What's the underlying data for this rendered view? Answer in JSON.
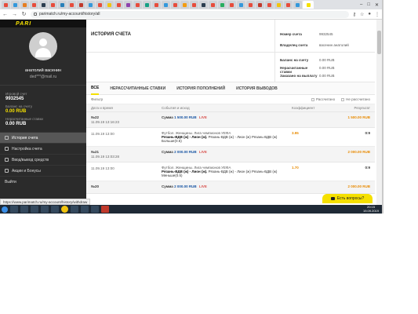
{
  "browser": {
    "url": "parimatch.ru/my-account/history/all",
    "status_url": "https://www.parimatch.ru/my-account/history/withdraw"
  },
  "colors": {
    "accent": "#f5e000",
    "sidebar": "#2b2b2b",
    "live": "#d9534f",
    "amount": "#e88a00"
  },
  "sidebar": {
    "user_name": "анатолий васенин",
    "user_email": "ded***@mail.ru",
    "account_label": "Игровой счет",
    "account_number": "9932545",
    "balance_label": "Баланс на счету",
    "balance_value": "0.00 RUB",
    "unsettled_label": "Нерасчитанные ставки",
    "unsettled_value": "0.00 RUB",
    "menu": [
      {
        "label": "История счета",
        "icon": "history-icon"
      },
      {
        "label": "Настройка счета",
        "icon": "settings-icon"
      },
      {
        "label": "Ввод/вывод средств",
        "icon": "wallet-icon"
      },
      {
        "label": "Акции и Бонусы",
        "icon": "gift-icon"
      },
      {
        "label": "Выйти",
        "icon": ""
      }
    ]
  },
  "main": {
    "title": "ИСТОРИЯ СЧЕТА",
    "account_number_label": "Номер счета",
    "account_number_value": "9932545",
    "owner_label": "Владелец счета",
    "owner_value": "васенин анатолий",
    "balance_label": "Баланс на счету",
    "balance_value": "0.00 RUB",
    "unsettled_label": "Нерасчитанные ставки",
    "unsettled_value": "0.00 RUB",
    "ordered_label": "Заказано на выплату",
    "ordered_value": "0.00 RUB",
    "tabs": [
      "ВСЕ",
      "НЕРАССЧИТАННЫЕ СТАВКИ",
      "ИСТОРИЯ ПОПОЛНЕНИЙ",
      "ИСТОРИЯ ВЫВОДОВ"
    ],
    "filter_label": "Фильтр",
    "filter_settled": "Рассчитано",
    "filter_unsettled": "Не рассчитано",
    "columns": [
      "Дата и время",
      "События и исход",
      "Коэффициент",
      "Результат"
    ],
    "bets": [
      {
        "number": "№22",
        "datetime": "11.09.19 13:16:23",
        "sum_label": "Сумма",
        "amount": "1 500.00 RUB",
        "live": "LIVE",
        "result": "1 500.00 RUB",
        "line_time": "11.09.19 13:00",
        "league": "Футбол. Женщины. Лига чемпионов УЕФА",
        "event_bold": "Рязань-ВДВ (ж) - Лион (ж).",
        "event_rest": "Рязань-ВДВ (ж) - Лион (ж) Рязань-ВДВ (ж) Больше(0.5)",
        "coef": "3.95",
        "score": "0:9"
      },
      {
        "number": "№21",
        "datetime": "11.09.19 13:03:28",
        "sum_label": "Сумма",
        "amount": "2 000.00 RUB",
        "live": "LIVE",
        "result": "2 000.00 RUB",
        "line_time": "11.09.19 13:00",
        "league": "Футбол. Женщины. Лига чемпионов УЕФА",
        "event_bold": "Рязань-ВДВ (ж) - Лион (ж).",
        "event_rest": "Рязань-ВДВ (ж) - Лион (ж) Рязань-ВДВ (ж) Меньше(0.5)",
        "coef": "1.70",
        "score": "0:9"
      },
      {
        "number": "№20",
        "datetime": "",
        "sum_label": "Сумма",
        "amount": "2 000.00 RUB",
        "live": "LIVE",
        "result": "2 000.00 RUB"
      }
    ]
  },
  "chat": {
    "label": "Есть вопросы?"
  },
  "taskbar": {
    "time": "20:15",
    "date": "19.09.2019"
  }
}
